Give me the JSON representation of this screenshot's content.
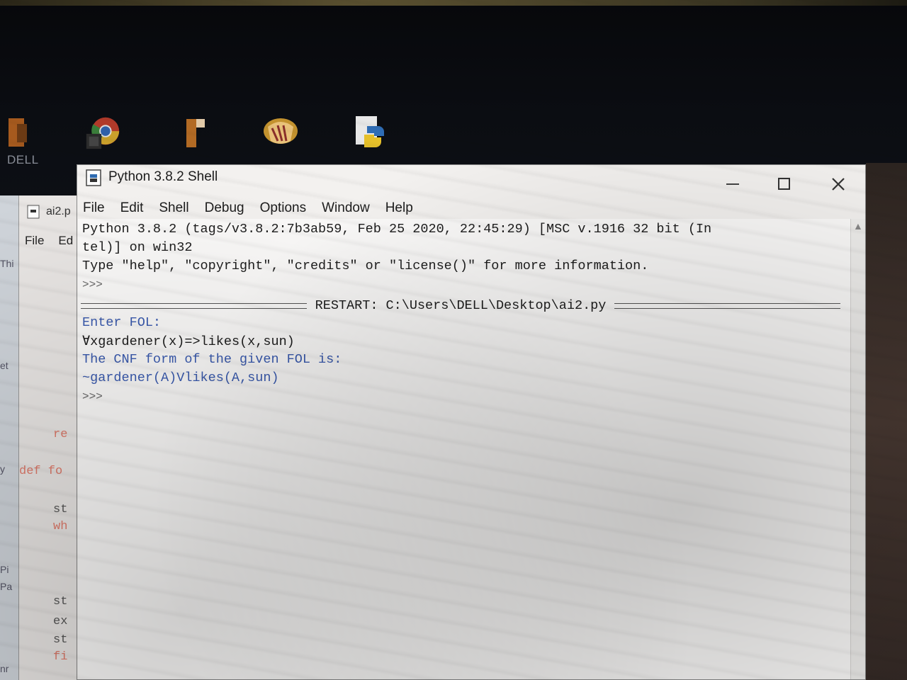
{
  "desktop": {
    "icons": [
      {
        "name": "file-manager-shortcut-icon"
      },
      {
        "name": "chrome-icon"
      },
      {
        "name": "shortcut-icon"
      },
      {
        "name": "hand-app-icon"
      },
      {
        "name": "python-file-icon"
      }
    ],
    "label": "DELL"
  },
  "background_window": {
    "title": "ai2.p",
    "menu": [
      "File",
      "Ed"
    ],
    "code_fragments": [
      "re",
      "def fo",
      "st",
      "wh",
      "st",
      "ex",
      "st",
      "fi"
    ],
    "edge_text": [
      "Thi",
      "et",
      "y",
      "Pi",
      "Pa",
      "nr"
    ]
  },
  "shell": {
    "title": "Python 3.8.2 Shell",
    "controls": {
      "minimize": "—",
      "maximize": "☐",
      "close": "✕"
    },
    "menu": [
      "File",
      "Edit",
      "Shell",
      "Debug",
      "Options",
      "Window",
      "Help"
    ],
    "banner_line1": "Python 3.8.2 (tags/v3.8.2:7b3ab59, Feb 25 2020, 22:45:29) [MSC v.1916 32 bit (In",
    "banner_line2": "tel)] on win32",
    "banner_line3": "Type \"help\", \"copyright\", \"credits\" or \"license()\" for more information.",
    "prompt": ">>>",
    "restart_text": "RESTART: C:\\Users\\DELL\\Desktop\\ai2.py",
    "enter_fol": "Enter FOL:",
    "user_input": "∀xgardener(x)=>likes(x,sun)",
    "cnf_label": "The CNF form of the given FOL is:",
    "cnf_result": "~gardener(A)Vlikes(A,sun)",
    "prompt_end": ">>>"
  },
  "colors": {
    "output_blue": "#3a5bb0",
    "window_bg": "#f3f1ef",
    "console_bg": "#fbfaf9"
  }
}
